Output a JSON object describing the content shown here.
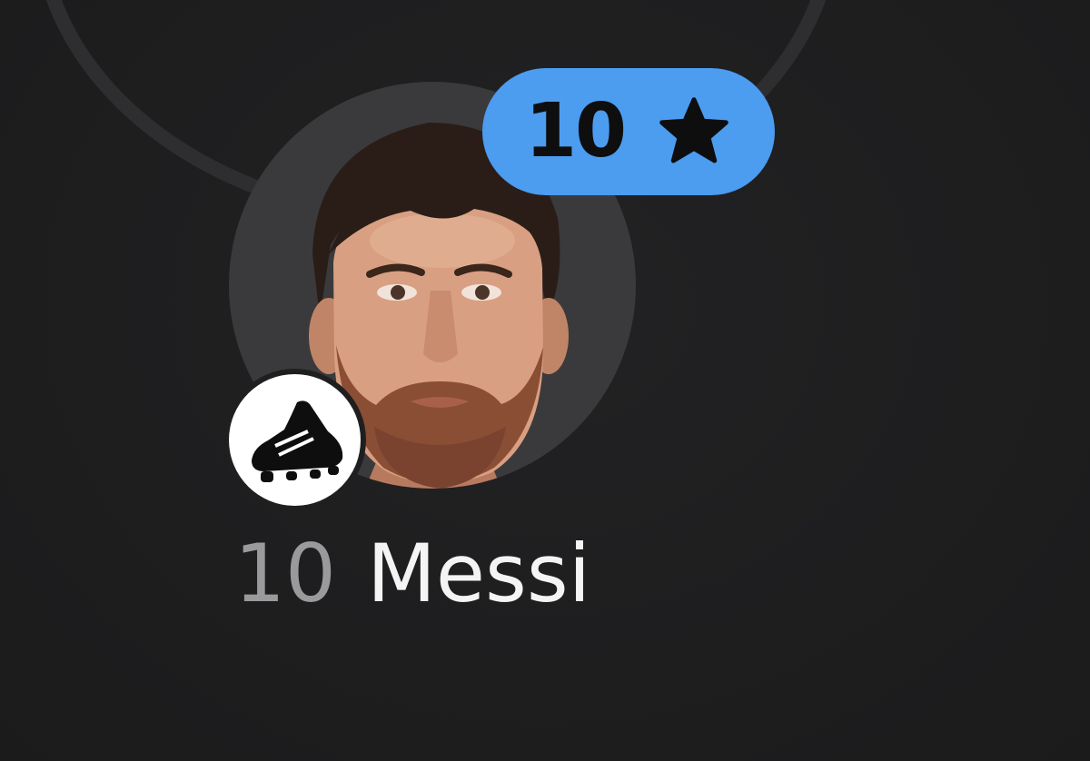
{
  "player": {
    "shirt_number": "10",
    "name": "Messi",
    "photo": "player-headshot",
    "position_icon": "football-boot-icon"
  },
  "rating": {
    "value": "10",
    "icon": "star-icon",
    "badge_color": "#4c9cf0"
  },
  "colors": {
    "background": "#1f1f20",
    "ring": "#3a3a3c",
    "name_text": "#f4f4f4",
    "number_text": "#9a9a9c"
  }
}
